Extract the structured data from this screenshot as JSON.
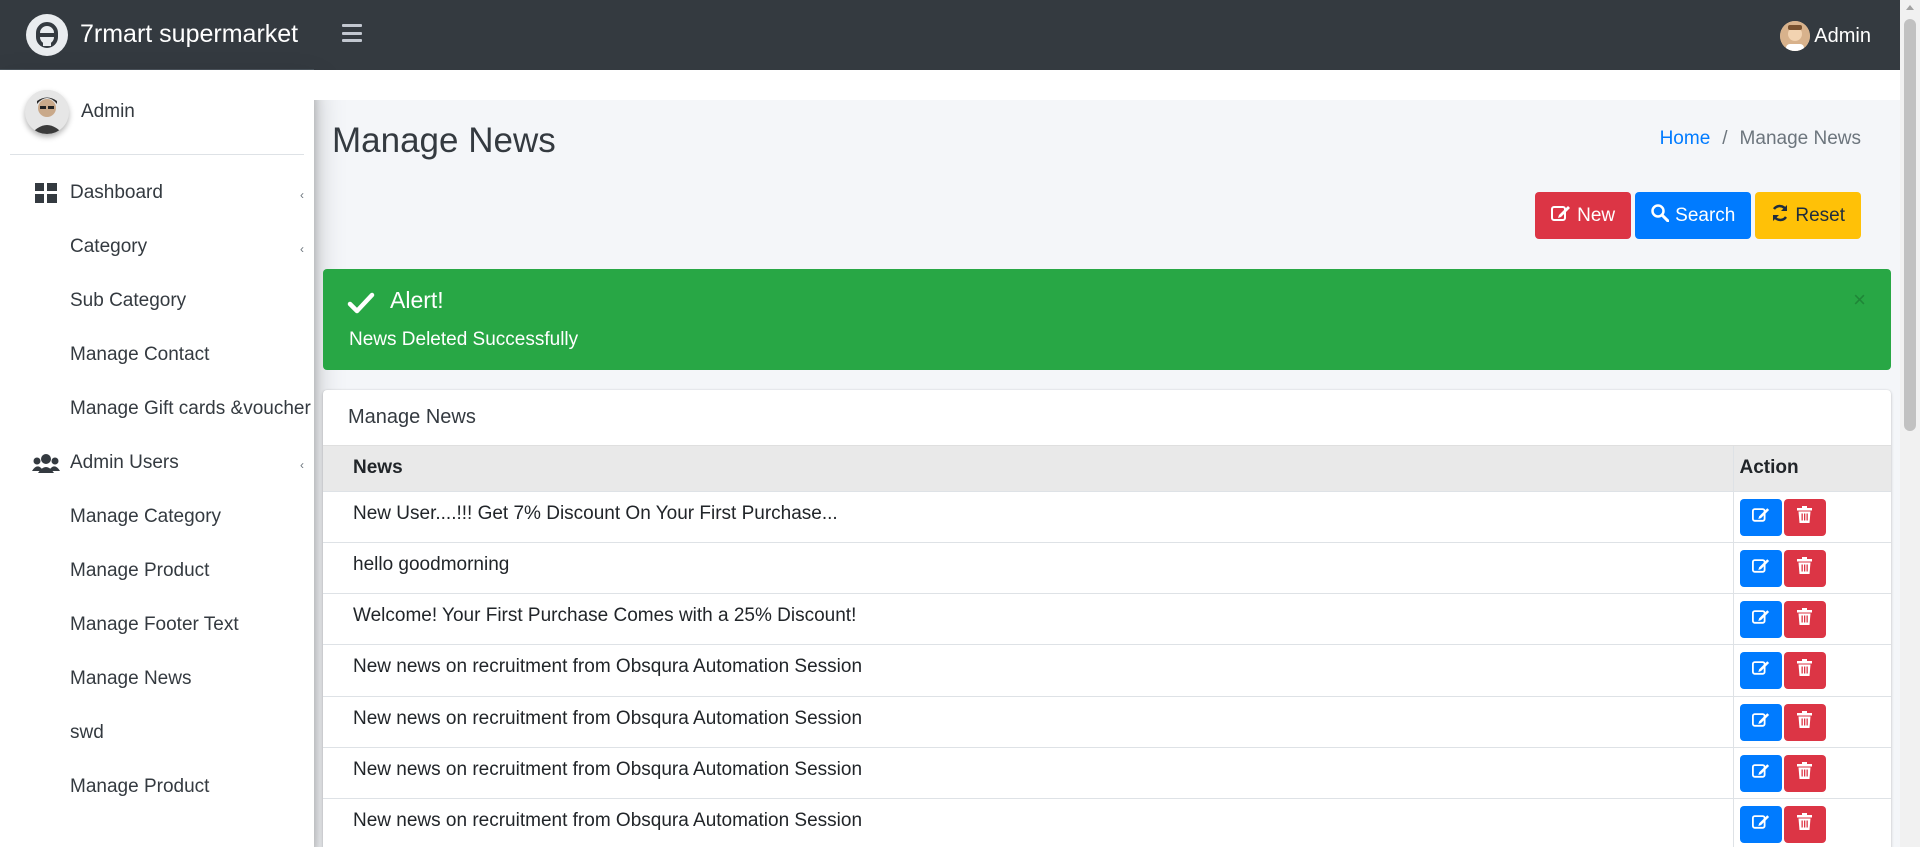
{
  "app": {
    "brand": "7rmart supermarket"
  },
  "sidebar": {
    "user": "Admin",
    "items": [
      {
        "label": "Dashboard",
        "icon": "dashboard-icon",
        "caret": true
      },
      {
        "label": "Category",
        "caret": true
      },
      {
        "label": "Sub Category"
      },
      {
        "label": "Manage Contact"
      },
      {
        "label": "Manage Gift cards &voucher"
      },
      {
        "label": "Admin Users",
        "icon": "users-icon",
        "caret": true
      },
      {
        "label": "Manage Category"
      },
      {
        "label": "Manage Product"
      },
      {
        "label": "Manage Footer Text"
      },
      {
        "label": "Manage News"
      },
      {
        "label": "swd"
      },
      {
        "label": "Manage Product"
      }
    ]
  },
  "topbar": {
    "user": "Admin"
  },
  "page": {
    "title": "Manage News",
    "breadcrumb": {
      "home": "Home",
      "sep": "/",
      "current": "Manage News"
    }
  },
  "toolbar": {
    "new_label": "New",
    "search_label": "Search",
    "reset_label": "Reset"
  },
  "alert": {
    "title": "Alert!",
    "message": "News Deleted Successfully",
    "close": "×"
  },
  "card": {
    "title": "Manage News",
    "columns": {
      "news": "News",
      "action": "Action"
    },
    "rows": [
      "New User....!!! Get 7% Discount On Your First Purchase...",
      "hello goodmorning",
      "Welcome! Your First Purchase Comes with a 25% Discount!",
      "New news on recruitment from Obsqura Automation Session",
      "New news on recruitment from Obsqura Automation Session",
      "New news on recruitment from Obsqura Automation Session",
      "New news on recruitment from Obsqura Automation Session"
    ]
  },
  "colors": {
    "topbar": "#343a40",
    "primary": "#007bff",
    "danger": "#dc3545",
    "warning": "#ffc107",
    "success": "#28a745"
  }
}
